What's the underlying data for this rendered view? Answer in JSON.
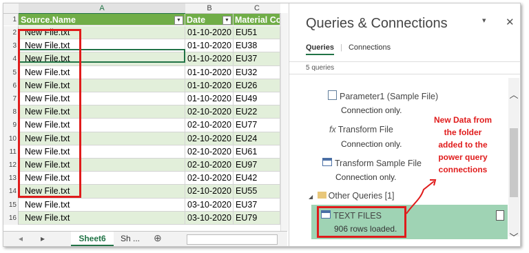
{
  "sheet": {
    "columns": [
      "A",
      "B",
      "C"
    ],
    "headers": [
      "Source.Name",
      "Date",
      "Material Co"
    ],
    "rows": [
      {
        "n": "2",
        "a": "New File.txt",
        "b": "01-10-2020",
        "c": "EU51"
      },
      {
        "n": "3",
        "a": "New File.txt",
        "b": "01-10-2020",
        "c": "EU38"
      },
      {
        "n": "4",
        "a": "New File.txt",
        "b": "01-10-2020",
        "c": "EU37"
      },
      {
        "n": "5",
        "a": "New File.txt",
        "b": "01-10-2020",
        "c": "EU32"
      },
      {
        "n": "6",
        "a": "New File.txt",
        "b": "01-10-2020",
        "c": "EU26"
      },
      {
        "n": "7",
        "a": "New File.txt",
        "b": "01-10-2020",
        "c": "EU49"
      },
      {
        "n": "8",
        "a": "New File.txt",
        "b": "02-10-2020",
        "c": "EU22"
      },
      {
        "n": "9",
        "a": "New File.txt",
        "b": "02-10-2020",
        "c": "EU77"
      },
      {
        "n": "10",
        "a": "New File.txt",
        "b": "02-10-2020",
        "c": "EU24"
      },
      {
        "n": "11",
        "a": "New File.txt",
        "b": "02-10-2020",
        "c": "EU61"
      },
      {
        "n": "12",
        "a": "New File.txt",
        "b": "02-10-2020",
        "c": "EU97"
      },
      {
        "n": "13",
        "a": "New File.txt",
        "b": "02-10-2020",
        "c": "EU42"
      },
      {
        "n": "14",
        "a": "New File.txt",
        "b": "02-10-2020",
        "c": "EU55"
      },
      {
        "n": "15",
        "a": "New File.txt",
        "b": "03-10-2020",
        "c": "EU37"
      },
      {
        "n": "16",
        "a": "New File.txt",
        "b": "03-10-2020",
        "c": "EU79"
      }
    ],
    "tabs": {
      "active": "Sheet6",
      "other": "Sh ...",
      "add": "⊕"
    },
    "colors": {
      "header_green": "#70ad47",
      "band_green": "#e2efda",
      "highlight_red": "#e01b1b"
    }
  },
  "pane": {
    "title": "Queries & Connections",
    "tab_queries": "Queries",
    "tab_connections": "Connections",
    "count": "5 queries",
    "items": [
      {
        "name": "Parameter1 (Sample File)",
        "status": "Connection only.",
        "icon": "parameter-icon"
      },
      {
        "name": "Transform File",
        "status": "Connection only.",
        "icon": "function-icon"
      },
      {
        "name": "Transform Sample File",
        "status": "Connection only.",
        "icon": "table-icon"
      }
    ],
    "group": "Other Queries [1]",
    "selected": {
      "name": "TEXT FILES",
      "status": "906 rows loaded."
    },
    "annotation": [
      "New Data from",
      "the folder",
      "added to the",
      "power query",
      "connections"
    ]
  }
}
